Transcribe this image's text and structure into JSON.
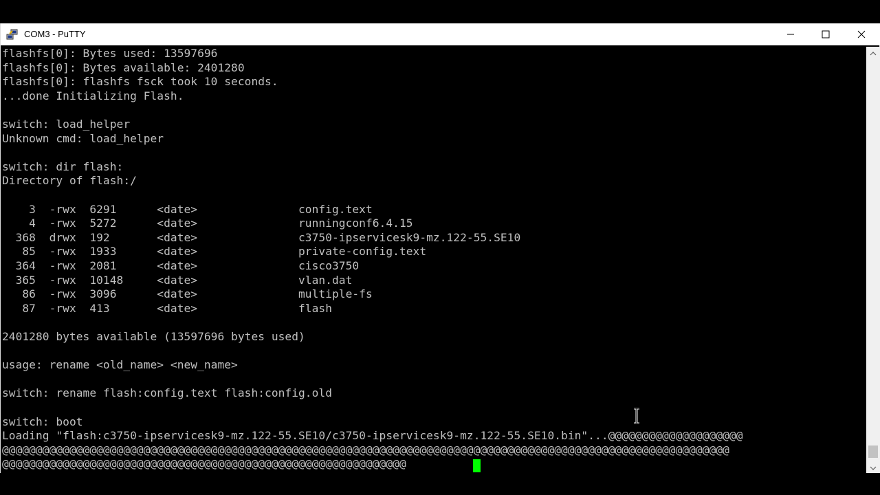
{
  "window": {
    "title": "COM3 - PuTTY",
    "icon": "putty-icon",
    "controls": {
      "minimize": "minimize-icon",
      "maximize": "maximize-icon",
      "close": "close-icon"
    }
  },
  "terminal": {
    "text_color": "#c0c0c0",
    "cursor_color": "#00ff00",
    "lines": [
      "flashfs[0]: Bytes used: 13597696",
      "flashfs[0]: Bytes available: 2401280",
      "flashfs[0]: flashfs fsck took 10 seconds.",
      "...done Initializing Flash.",
      "",
      "switch: load_helper",
      "Unknown cmd: load_helper",
      "",
      "switch: dir flash:",
      "Directory of flash:/",
      "",
      "    3  -rwx  6291      <date>               config.text",
      "    4  -rwx  5272      <date>               runningconf6.4.15",
      "  368  drwx  192       <date>               c3750-ipservicesk9-mz.122-55.SE10",
      "   85  -rwx  1933      <date>               private-config.text",
      "  364  -rwx  2081      <date>               cisco3750",
      "  365  -rwx  10148     <date>               vlan.dat",
      "   86  -rwx  3096      <date>               multiple-fs",
      "   87  -rwx  413       <date>               flash",
      "",
      "2401280 bytes available (13597696 bytes used)",
      "",
      "usage: rename <old_name> <new_name>",
      "",
      "switch: rename flash:config.text flash:config.old",
      "",
      "switch: boot",
      "Loading \"flash:c3750-ipservicesk9-mz.122-55.SE10/c3750-ipservicesk9-mz.122-55.SE10.bin\"...@@@@@@@@@@@@@@@@@@@@",
      "@@@@@@@@@@@@@@@@@@@@@@@@@@@@@@@@@@@@@@@@@@@@@@@@@@@@@@@@@@@@@@@@@@@@@@@@@@@@@@@@@@@@@@@@@@@@@@@@@@@@@@@@@@@@",
      "@@@@@@@@@@@@@@@@@@@@@@@@@@@@@@@@@@@@@@@@@@@@@@@@@@@@@@@@@@@@"
    ]
  },
  "scrollbar": {
    "up": "scroll-up-arrow-icon",
    "down": "scroll-down-arrow-icon"
  },
  "mouse_cursor": "text-ibeam-cursor-icon"
}
